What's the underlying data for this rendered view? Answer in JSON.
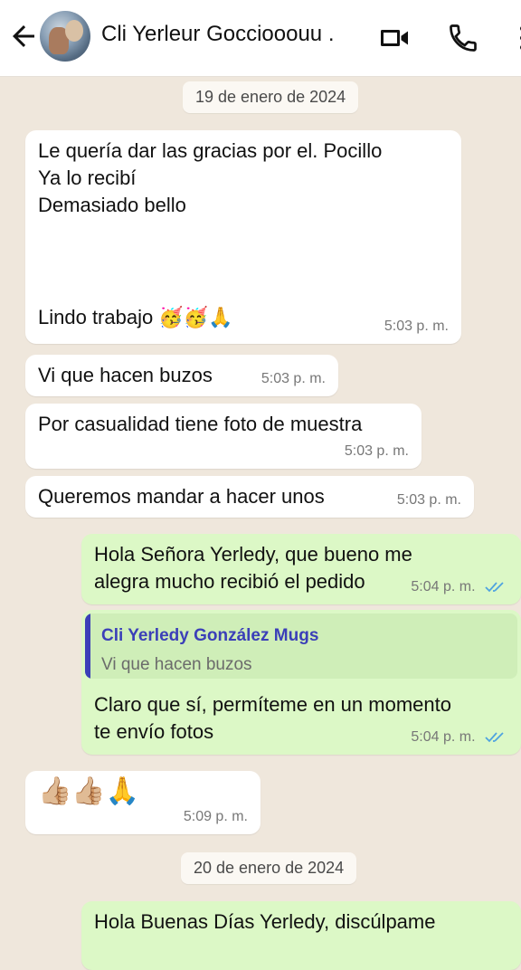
{
  "header": {
    "title": "Cli Yerleur Gocciooouu .",
    "icons": [
      "back-arrow-icon",
      "avatar",
      "video-call-icon",
      "phone-icon",
      "more-vert-icon"
    ]
  },
  "dates": [
    "19 de enero de 2024",
    "20 de enero de 2024"
  ],
  "messages": [
    {
      "dir": "in",
      "lines": [
        "Le quería dar las gracias por el. Pocillo",
        "Ya lo recibí",
        "Demasiado bello"
      ],
      "last_line": "Lindo trabajo 🥳🥳🙏",
      "time": "5:03 p. m."
    },
    {
      "dir": "in",
      "text": "Vi que hacen buzos",
      "time": "5:03 p. m."
    },
    {
      "dir": "in",
      "text": "Por casualidad tiene foto de muestra",
      "time": "5:03 p. m."
    },
    {
      "dir": "in",
      "text": "Queremos mandar a hacer unos",
      "time": "5:03 p. m."
    },
    {
      "dir": "out",
      "lines": [
        "Hola Señora Yerledy, que bueno me",
        "alegra mucho recibió el pedido"
      ],
      "time": "5:04 p. m.",
      "status": "read"
    },
    {
      "dir": "out",
      "quote_name": "Cli Yerledy González Mugs",
      "quote_text": "Vi que hacen buzos",
      "lines": [
        "Claro que sí, permíteme en un momento",
        "te envío fotos"
      ],
      "time": "5:04 p. m.",
      "status": "read"
    },
    {
      "dir": "in",
      "text": "👍🏼👍🏼🙏",
      "time": "5:09 p. m."
    },
    {
      "dir": "out",
      "text": "Hola Buenas Días Yerledy, discúlpame"
    }
  ],
  "colors": {
    "chat_bg": "#efe7dc",
    "incoming": "#ffffff",
    "outgoing": "#dcf8c6",
    "read_ticks": "#4fa3e0",
    "quote_accent": "#3b3fb8"
  }
}
